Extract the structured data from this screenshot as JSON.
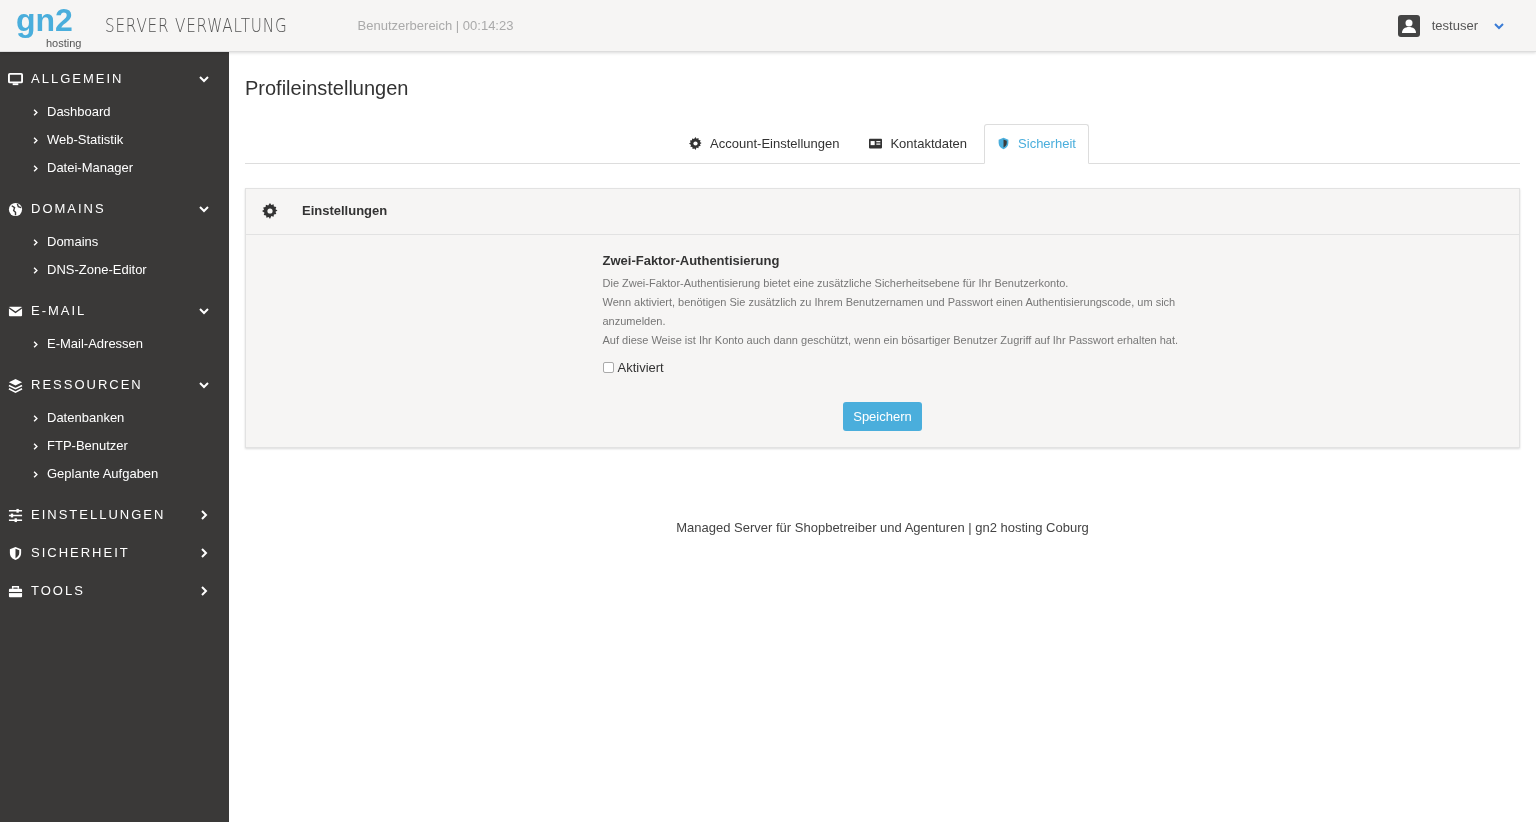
{
  "header": {
    "logo": {
      "mark": "gn2",
      "sub": "hosting"
    },
    "title": "SERVER VERWALTUNG",
    "session": "Benutzerbereich | 00:14:23",
    "user": "testuser"
  },
  "sidebar": {
    "groups": [
      {
        "label": "ALLGEMEIN",
        "expanded": true,
        "items": [
          "Dashboard",
          "Web-Statistik",
          "Datei-Manager"
        ]
      },
      {
        "label": "DOMAINS",
        "expanded": true,
        "items": [
          "Domains",
          "DNS-Zone-Editor"
        ]
      },
      {
        "label": "E-MAIL",
        "expanded": true,
        "items": [
          "E-Mail-Adressen"
        ]
      },
      {
        "label": "RESSOURCEN",
        "expanded": true,
        "items": [
          "Datenbanken",
          "FTP-Benutzer",
          "Geplante Aufgaben"
        ]
      },
      {
        "label": "EINSTELLUNGEN",
        "expanded": false
      },
      {
        "label": "SICHERHEIT",
        "expanded": false
      },
      {
        "label": "TOOLS",
        "expanded": false
      }
    ]
  },
  "page": {
    "title": "Profileinstellungen",
    "tabs": [
      {
        "label": "Account-Einstellungen",
        "selected": false
      },
      {
        "label": "Kontaktdaten",
        "selected": false
      },
      {
        "label": "Sicherheit",
        "selected": true
      }
    ],
    "panel": {
      "title": "Einstellungen",
      "section_title": "Zwei-Faktor-Authentisierung",
      "paragraphs": [
        "Die Zwei-Faktor-Authentisierung bietet eine zusätzliche Sicherheitsebene für Ihr Benutzerkonto.",
        "Wenn aktiviert, benötigen Sie zusätzlich zu Ihrem Benutzernamen und Passwort einen Authentisierungscode, um sich anzumelden.",
        "Auf diese Weise ist Ihr Konto auch dann geschützt, wenn ein bösartiger Benutzer Zugriff auf Ihr Passwort erhalten hat."
      ],
      "checkbox": {
        "label": "Aktiviert",
        "checked": false
      },
      "button": "Speichern"
    }
  },
  "footer": "Managed Server für Shopbetreiber und Agenturen | gn2 hosting Coburg"
}
